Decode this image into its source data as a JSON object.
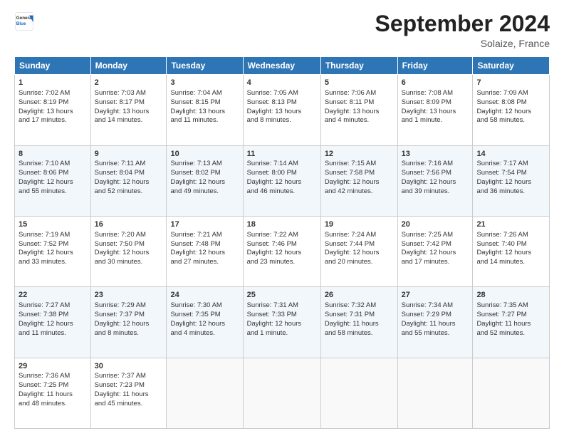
{
  "header": {
    "logo_general": "General",
    "logo_blue": "Blue",
    "month_title": "September 2024",
    "location": "Solaize, France"
  },
  "days_of_week": [
    "Sunday",
    "Monday",
    "Tuesday",
    "Wednesday",
    "Thursday",
    "Friday",
    "Saturday"
  ],
  "weeks": [
    [
      {
        "day": "1",
        "lines": [
          "Sunrise: 7:02 AM",
          "Sunset: 8:19 PM",
          "Daylight: 13 hours",
          "and 17 minutes."
        ]
      },
      {
        "day": "2",
        "lines": [
          "Sunrise: 7:03 AM",
          "Sunset: 8:17 PM",
          "Daylight: 13 hours",
          "and 14 minutes."
        ]
      },
      {
        "day": "3",
        "lines": [
          "Sunrise: 7:04 AM",
          "Sunset: 8:15 PM",
          "Daylight: 13 hours",
          "and 11 minutes."
        ]
      },
      {
        "day": "4",
        "lines": [
          "Sunrise: 7:05 AM",
          "Sunset: 8:13 PM",
          "Daylight: 13 hours",
          "and 8 minutes."
        ]
      },
      {
        "day": "5",
        "lines": [
          "Sunrise: 7:06 AM",
          "Sunset: 8:11 PM",
          "Daylight: 13 hours",
          "and 4 minutes."
        ]
      },
      {
        "day": "6",
        "lines": [
          "Sunrise: 7:08 AM",
          "Sunset: 8:09 PM",
          "Daylight: 13 hours",
          "and 1 minute."
        ]
      },
      {
        "day": "7",
        "lines": [
          "Sunrise: 7:09 AM",
          "Sunset: 8:08 PM",
          "Daylight: 12 hours",
          "and 58 minutes."
        ]
      }
    ],
    [
      {
        "day": "8",
        "lines": [
          "Sunrise: 7:10 AM",
          "Sunset: 8:06 PM",
          "Daylight: 12 hours",
          "and 55 minutes."
        ]
      },
      {
        "day": "9",
        "lines": [
          "Sunrise: 7:11 AM",
          "Sunset: 8:04 PM",
          "Daylight: 12 hours",
          "and 52 minutes."
        ]
      },
      {
        "day": "10",
        "lines": [
          "Sunrise: 7:13 AM",
          "Sunset: 8:02 PM",
          "Daylight: 12 hours",
          "and 49 minutes."
        ]
      },
      {
        "day": "11",
        "lines": [
          "Sunrise: 7:14 AM",
          "Sunset: 8:00 PM",
          "Daylight: 12 hours",
          "and 46 minutes."
        ]
      },
      {
        "day": "12",
        "lines": [
          "Sunrise: 7:15 AM",
          "Sunset: 7:58 PM",
          "Daylight: 12 hours",
          "and 42 minutes."
        ]
      },
      {
        "day": "13",
        "lines": [
          "Sunrise: 7:16 AM",
          "Sunset: 7:56 PM",
          "Daylight: 12 hours",
          "and 39 minutes."
        ]
      },
      {
        "day": "14",
        "lines": [
          "Sunrise: 7:17 AM",
          "Sunset: 7:54 PM",
          "Daylight: 12 hours",
          "and 36 minutes."
        ]
      }
    ],
    [
      {
        "day": "15",
        "lines": [
          "Sunrise: 7:19 AM",
          "Sunset: 7:52 PM",
          "Daylight: 12 hours",
          "and 33 minutes."
        ]
      },
      {
        "day": "16",
        "lines": [
          "Sunrise: 7:20 AM",
          "Sunset: 7:50 PM",
          "Daylight: 12 hours",
          "and 30 minutes."
        ]
      },
      {
        "day": "17",
        "lines": [
          "Sunrise: 7:21 AM",
          "Sunset: 7:48 PM",
          "Daylight: 12 hours",
          "and 27 minutes."
        ]
      },
      {
        "day": "18",
        "lines": [
          "Sunrise: 7:22 AM",
          "Sunset: 7:46 PM",
          "Daylight: 12 hours",
          "and 23 minutes."
        ]
      },
      {
        "day": "19",
        "lines": [
          "Sunrise: 7:24 AM",
          "Sunset: 7:44 PM",
          "Daylight: 12 hours",
          "and 20 minutes."
        ]
      },
      {
        "day": "20",
        "lines": [
          "Sunrise: 7:25 AM",
          "Sunset: 7:42 PM",
          "Daylight: 12 hours",
          "and 17 minutes."
        ]
      },
      {
        "day": "21",
        "lines": [
          "Sunrise: 7:26 AM",
          "Sunset: 7:40 PM",
          "Daylight: 12 hours",
          "and 14 minutes."
        ]
      }
    ],
    [
      {
        "day": "22",
        "lines": [
          "Sunrise: 7:27 AM",
          "Sunset: 7:38 PM",
          "Daylight: 12 hours",
          "and 11 minutes."
        ]
      },
      {
        "day": "23",
        "lines": [
          "Sunrise: 7:29 AM",
          "Sunset: 7:37 PM",
          "Daylight: 12 hours",
          "and 8 minutes."
        ]
      },
      {
        "day": "24",
        "lines": [
          "Sunrise: 7:30 AM",
          "Sunset: 7:35 PM",
          "Daylight: 12 hours",
          "and 4 minutes."
        ]
      },
      {
        "day": "25",
        "lines": [
          "Sunrise: 7:31 AM",
          "Sunset: 7:33 PM",
          "Daylight: 12 hours",
          "and 1 minute."
        ]
      },
      {
        "day": "26",
        "lines": [
          "Sunrise: 7:32 AM",
          "Sunset: 7:31 PM",
          "Daylight: 11 hours",
          "and 58 minutes."
        ]
      },
      {
        "day": "27",
        "lines": [
          "Sunrise: 7:34 AM",
          "Sunset: 7:29 PM",
          "Daylight: 11 hours",
          "and 55 minutes."
        ]
      },
      {
        "day": "28",
        "lines": [
          "Sunrise: 7:35 AM",
          "Sunset: 7:27 PM",
          "Daylight: 11 hours",
          "and 52 minutes."
        ]
      }
    ],
    [
      {
        "day": "29",
        "lines": [
          "Sunrise: 7:36 AM",
          "Sunset: 7:25 PM",
          "Daylight: 11 hours",
          "and 48 minutes."
        ]
      },
      {
        "day": "30",
        "lines": [
          "Sunrise: 7:37 AM",
          "Sunset: 7:23 PM",
          "Daylight: 11 hours",
          "and 45 minutes."
        ]
      },
      null,
      null,
      null,
      null,
      null
    ]
  ]
}
